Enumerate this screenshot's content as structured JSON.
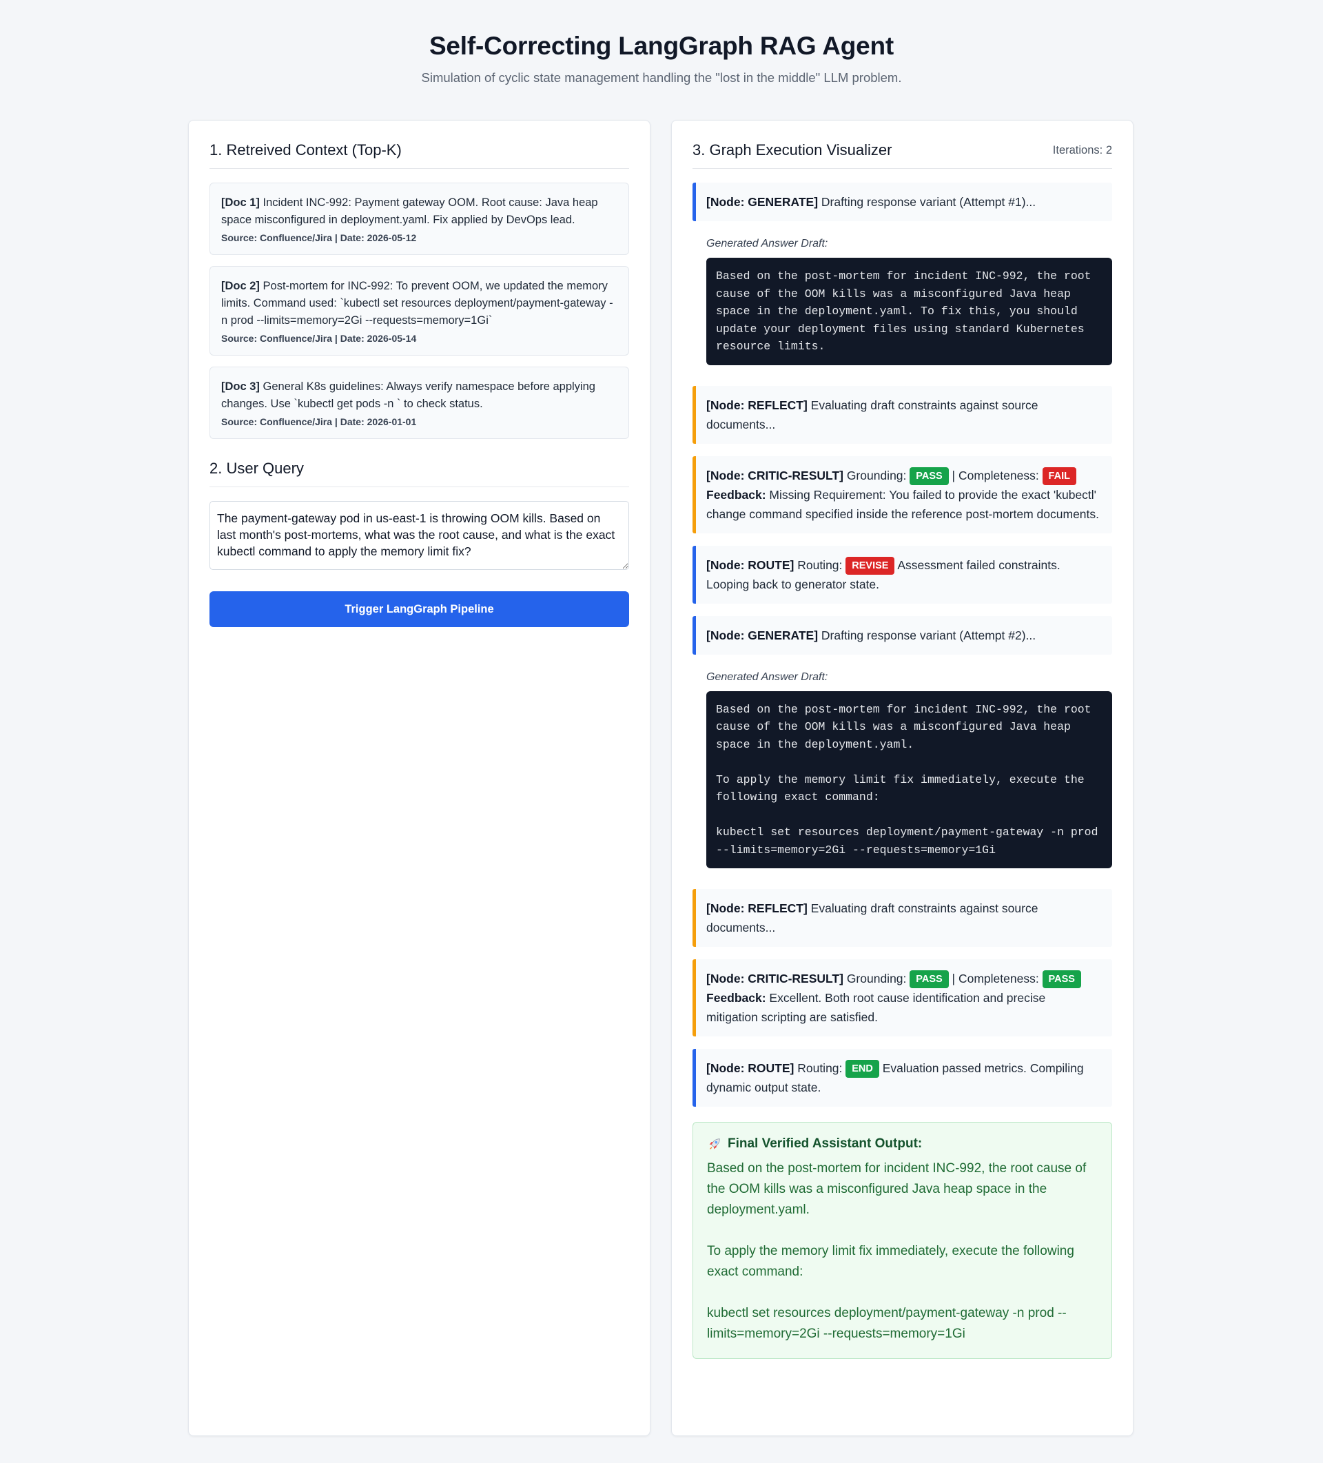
{
  "page": {
    "title": "Self-Correcting LangGraph RAG Agent",
    "subtitle": "Simulation of cyclic state management handling the \"lost in the middle\" LLM problem."
  },
  "left": {
    "context_heading": "1. Retreived Context (Top-K)",
    "docs": [
      {
        "id": "[Doc 1]",
        "text": "Incident INC-992: Payment gateway OOM. Root cause: Java heap space misconfigured in deployment.yaml. Fix applied by DevOps lead.",
        "source": "Source: Confluence/Jira | Date: 2026-05-12"
      },
      {
        "id": "[Doc 2]",
        "text": "Post-mortem for INC-992: To prevent OOM, we updated the memory limits. Command used: `kubectl set resources deployment/payment-gateway -n prod --limits=memory=2Gi --requests=memory=1Gi`",
        "source": "Source: Confluence/Jira | Date: 2026-05-14"
      },
      {
        "id": "[Doc 3]",
        "text": "General K8s guidelines: Always verify namespace before applying changes. Use `kubectl get pods -n ` to check status.",
        "source": "Source: Confluence/Jira | Date: 2026-01-01"
      }
    ],
    "query_heading": "2. User Query",
    "query_value": "The payment-gateway pod in us-east-1 is throwing OOM kills. Based on last month's post-mortems, what was the root cause, and what is the exact kubectl command to apply the memory limit fix?",
    "trigger_label": "Trigger LangGraph Pipeline"
  },
  "right": {
    "heading": "3. Graph Execution Visualizer",
    "iterations": "Iterations: 2",
    "draft_label": "Generated Answer Draft:",
    "log": {
      "gen1_node": "[Node: GENERATE]",
      "gen1_text": " Drafting response variant (Attempt #1)...",
      "draft1": "Based on the post-mortem for incident INC-992, the root cause of the OOM kills was a misconfigured Java heap space in the deployment.yaml. To fix this, you should update your deployment files using standard Kubernetes resource limits.",
      "reflect1_node": "[Node: REFLECT]",
      "reflect1_text": " Evaluating draft constraints against source documents...",
      "critic1_node": "[Node: CRITIC-RESULT]",
      "critic1_grounding": " Grounding: ",
      "critic1_grounding_badge": "PASS",
      "critic1_completeness": " | Completeness: ",
      "critic1_completeness_badge": "FAIL",
      "critic1_feedback_label": "Feedback:",
      "critic1_feedback": " Missing Requirement: You failed to provide the exact 'kubectl' change command specified inside the reference post-mortem documents.",
      "route1_node": "[Node: ROUTE]",
      "route1_routing": " Routing: ",
      "route1_badge": "REVISE",
      "route1_text": " Assessment failed constraints. Looping back to generator state.",
      "gen2_node": "[Node: GENERATE]",
      "gen2_text": " Drafting response variant (Attempt #2)...",
      "draft2": "Based on the post-mortem for incident INC-992, the root cause of the OOM kills was a misconfigured Java heap space in the deployment.yaml.\n\nTo apply the memory limit fix immediately, execute the following exact command:\n\nkubectl set resources deployment/payment-gateway -n prod --limits=memory=2Gi --requests=memory=1Gi",
      "reflect2_node": "[Node: REFLECT]",
      "reflect2_text": " Evaluating draft constraints against source documents...",
      "critic2_node": "[Node: CRITIC-RESULT]",
      "critic2_grounding": " Grounding: ",
      "critic2_grounding_badge": "PASS",
      "critic2_completeness": " | Completeness: ",
      "critic2_completeness_badge": "PASS",
      "critic2_feedback_label": "Feedback:",
      "critic2_feedback": " Excellent. Both root cause identification and precise mitigation scripting are satisfied.",
      "route2_node": "[Node: ROUTE]",
      "route2_routing": " Routing: ",
      "route2_badge": "END",
      "route2_text": " Evaluation passed metrics. Compiling dynamic output state."
    },
    "final": {
      "icon": "rocket-icon",
      "title": "Final Verified Assistant Output:",
      "text": "Based on the post-mortem for incident INC-992, the root cause of the OOM kills was a misconfigured Java heap space in the deployment.yaml.\n\nTo apply the memory limit fix immediately, execute the following exact command:\n\nkubectl set resources deployment/payment-gateway -n prod --limits=memory=2Gi --requests=memory=1Gi"
    }
  },
  "colors": {
    "accent_blue": "#2563eb",
    "reflect_amber": "#f59e0b",
    "pass_green": "#16a34a",
    "fail_red": "#dc2626"
  }
}
